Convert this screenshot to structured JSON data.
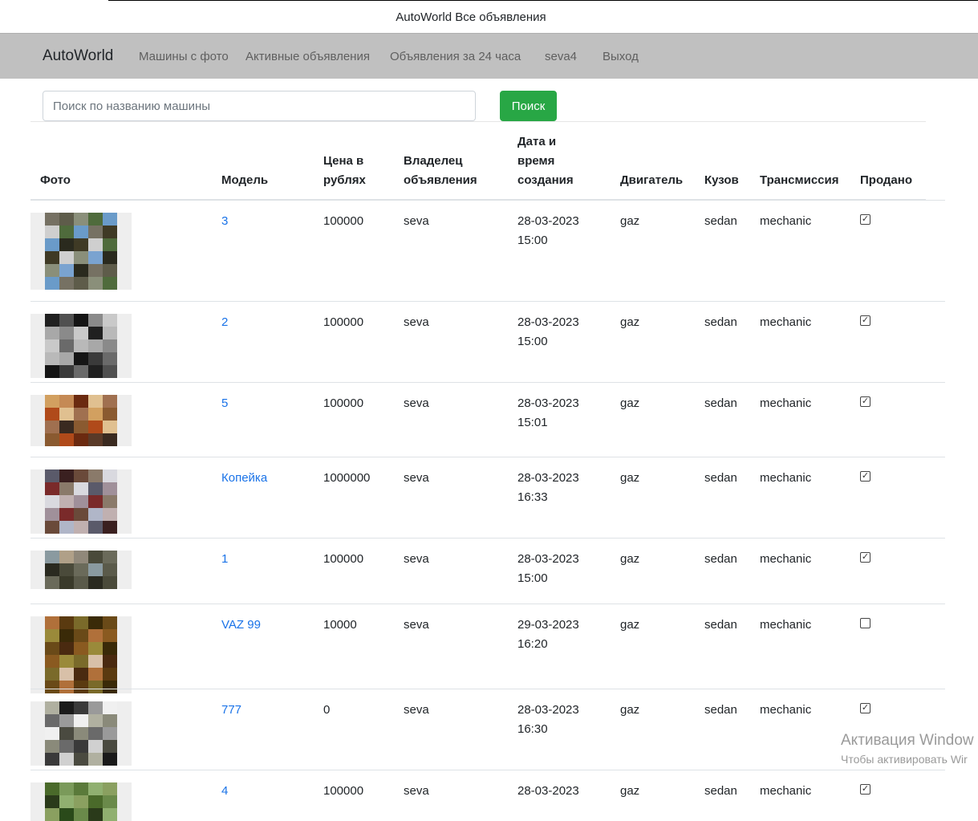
{
  "window": {
    "title": "AutoWorld Все объявления"
  },
  "navbar": {
    "brand": "AutoWorld",
    "links": [
      "Машины с фото",
      "Активные объявления",
      "Объявления за 24 часа",
      "seva4",
      "Выход"
    ],
    "bg_color": "#c0c0c0"
  },
  "search": {
    "placeholder": "Поиск по названию машины",
    "value": "",
    "button_label": "Поиск",
    "button_color": "#28a745"
  },
  "table": {
    "headers": {
      "photo": "Фото",
      "model": "Модель",
      "price": [
        "Цена в",
        "рублях"
      ],
      "owner": [
        "Владелец",
        "объявления"
      ],
      "created": [
        "Дата и",
        "время",
        "создания"
      ],
      "engine": "Двигатель",
      "body": "Кузов",
      "transmission": "Трансмиссия",
      "sold": "Продано"
    },
    "rows": [
      {
        "model": "3",
        "price": "100000",
        "owner": "seva",
        "date": "28-03-2023",
        "time": "15:00",
        "engine": "gaz",
        "body": "sedan",
        "transmission": "mechanic",
        "sold": true
      },
      {
        "model": "2",
        "price": "100000",
        "owner": "seva",
        "date": "28-03-2023",
        "time": "15:00",
        "engine": "gaz",
        "body": "sedan",
        "transmission": "mechanic",
        "sold": true
      },
      {
        "model": "5",
        "price": "100000",
        "owner": "seva",
        "date": "28-03-2023",
        "time": "15:01",
        "engine": "gaz",
        "body": "sedan",
        "transmission": "mechanic",
        "sold": true
      },
      {
        "model": "Копейка",
        "price": "1000000",
        "owner": "seva",
        "date": "28-03-2023",
        "time": "16:33",
        "engine": "gaz",
        "body": "sedan",
        "transmission": "mechanic",
        "sold": true
      },
      {
        "model": "1",
        "price": "100000",
        "owner": "seva",
        "date": "28-03-2023",
        "time": "15:00",
        "engine": "gaz",
        "body": "sedan",
        "transmission": "mechanic",
        "sold": true
      },
      {
        "model": "VAZ 99",
        "price": "10000",
        "owner": "seva",
        "date": "29-03-2023",
        "time": "16:20",
        "engine": "gaz",
        "body": "sedan",
        "transmission": "mechanic",
        "sold": false
      },
      {
        "model": "777",
        "price": "0",
        "owner": "seva",
        "date": "28-03-2023",
        "time": "16:30",
        "engine": "gaz",
        "body": "sedan",
        "transmission": "mechanic",
        "sold": true
      },
      {
        "model": "4",
        "price": "100000",
        "owner": "seva",
        "date": "28-03-2023",
        "time": "",
        "engine": "gaz",
        "body": "sedan",
        "transmission": "mechanic",
        "sold": true
      }
    ]
  },
  "overlay": {
    "activation_title": "Активация Window",
    "activation_text": "Чтобы активировать Wir"
  },
  "colors": {
    "link": "#1a73e8",
    "success": "#28a745"
  }
}
